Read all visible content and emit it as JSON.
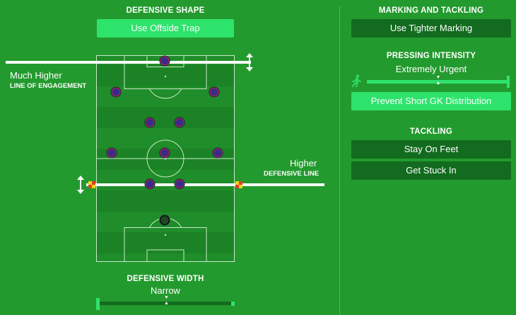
{
  "left": {
    "defensive_shape_heading": "DEFENSIVE SHAPE",
    "offside_trap_button": "Use Offside Trap",
    "line_of_engagement_value": "Much Higher",
    "line_of_engagement_label": "LINE OF ENGAGEMENT",
    "defensive_line_value": "Higher",
    "defensive_line_label": "DEFENSIVE LINE",
    "defensive_width_heading": "DEFENSIVE WIDTH",
    "defensive_width_value": "Narrow",
    "defensive_width_level": 0.5
  },
  "right": {
    "marking_heading": "MARKING AND TACKLING",
    "tighter_marking_button": "Use Tighter Marking",
    "pressing_heading": "PRESSING INTENSITY",
    "pressing_value": "Extremely Urgent",
    "pressing_level": 0.5,
    "prevent_gk_button": "Prevent Short GK Distribution",
    "tackling_heading": "TACKLING",
    "stay_on_feet_button": "Stay On Feet",
    "get_stuck_in_button": "Get Stuck In"
  },
  "colors": {
    "background": "#239a2e",
    "button_dark": "#126b1e",
    "button_bright": "#2ee36c",
    "player_fill": "#3b2a86",
    "player_ring": "#c42a5a"
  },
  "icons": {
    "pressing": "running-man-icon",
    "line_handle": "vertical-resize-arrow-icon",
    "corner_flag": "checkered-flag-icon"
  }
}
